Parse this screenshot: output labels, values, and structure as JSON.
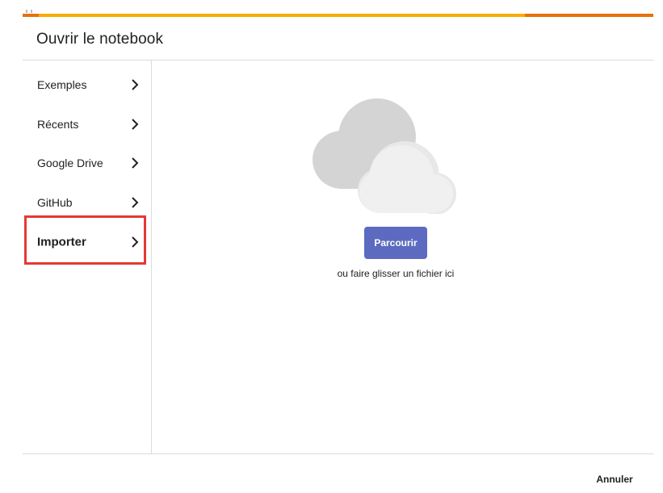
{
  "dialog": {
    "title": "Ouvrir le notebook"
  },
  "sidebar": {
    "items": [
      {
        "label": "Exemples",
        "icon": "chevron-right-icon"
      },
      {
        "label": "Récents",
        "icon": "chevron-right-icon"
      },
      {
        "label": "Google Drive",
        "icon": "chevron-right-icon"
      },
      {
        "label": "GitHub",
        "icon": "chevron-right-icon"
      },
      {
        "label": "Importer",
        "icon": "chevron-right-icon",
        "selected": true
      }
    ]
  },
  "upload": {
    "icon": "cloud-icon",
    "browse_label": "Parcourir",
    "drop_hint": "ou faire glisser un fichier ici"
  },
  "footer": {
    "cancel_label": "Annuler"
  },
  "colors": {
    "accent_button": "#5c6bc0",
    "highlight_border": "#e53935",
    "top_strip_yellow": "#f9ab00",
    "top_strip_orange": "#e8710a",
    "divider": "#dadce0"
  }
}
